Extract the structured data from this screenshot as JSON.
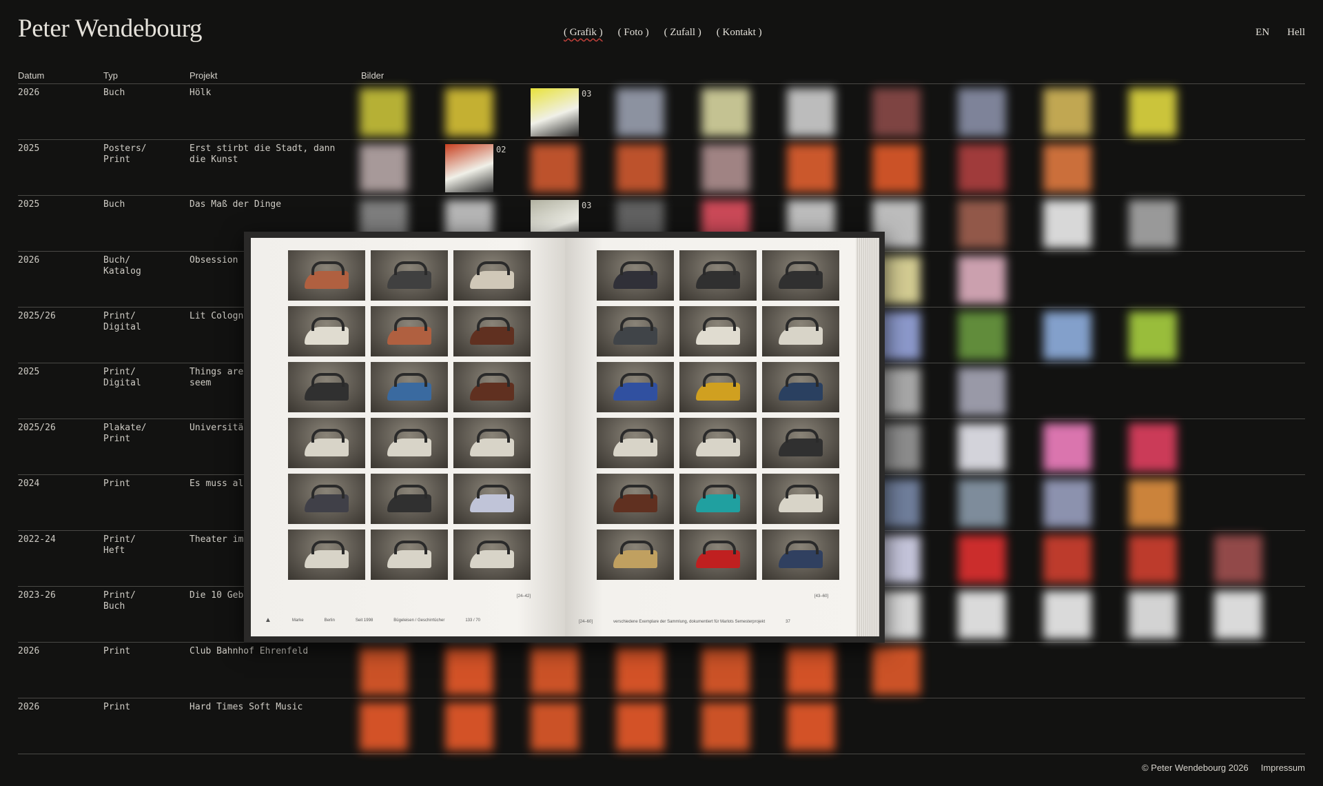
{
  "site": {
    "title": "Peter Wendebourg"
  },
  "nav": {
    "items": [
      "( Grafik )",
      "( Foto )",
      "( Zufall )",
      "( Kontakt )"
    ],
    "active": 0
  },
  "utility": {
    "language": "EN",
    "theme": "Hell"
  },
  "table": {
    "headers": {
      "date": "Datum",
      "type": "Typ",
      "project": "Projekt",
      "images": "Bilder"
    },
    "rows": [
      {
        "date": "2026",
        "type": "Buch",
        "project": "Hölk",
        "thumbs": 10,
        "sharp_index": 2,
        "count": "03",
        "colors": [
          "#c8c23a",
          "#d8c236",
          "#e8e23a",
          "#9aa0b0",
          "#d8d6a0",
          "#cfcfcf",
          "#8a4a48",
          "#8a90a8",
          "#d4b85a",
          "#e0d840"
        ]
      },
      {
        "date": "2025",
        "type": "Posters/\nPrint",
        "project": "Erst stirbt die Stadt, dann\ndie Kunst",
        "thumbs": 9,
        "sharp_index": 1,
        "count": "02",
        "colors": [
          "#b8a8a8",
          "#c84020",
          "#d05a30",
          "#d05a30",
          "#b09090",
          "#e06030",
          "#e05a2a",
          "#b04040",
          "#e07a40"
        ]
      },
      {
        "date": "2025",
        "type": "Buch",
        "project": "Das Maß der Dinge",
        "thumbs": 10,
        "sharp_index": 2,
        "count": "03",
        "colors": [
          "#8a8a8a",
          "#c8c8c8",
          "#b0b0a0",
          "#6a6a6a",
          "#e05060",
          "#d0d0d0",
          "#cfcfcf",
          "#a06050",
          "#eeeeee",
          "#a8a8a8"
        ]
      },
      {
        "date": "2026",
        "type": "Buch/\nKatalog",
        "project": "Obsession",
        "thumbs": 8,
        "sharp_index": -1,
        "count": "",
        "colors": [
          "#d0c8a0",
          "#c0c0c0",
          "#d0d0b0",
          "#a0a0a0",
          "#b0b0b0",
          "#c0c0b0",
          "#e8e0a0",
          "#e0b0c0"
        ]
      },
      {
        "date": "2025/26",
        "type": "Print/\nDigital",
        "project": "Lit Cologn",
        "thumbs": 10,
        "sharp_index": -1,
        "count": "",
        "colors": [
          "#a0a0d0",
          "#7080c0",
          "#8090c0",
          "#b0b0e0",
          "#8080a0",
          "#9090b0",
          "#9aa8e0",
          "#6a9a40",
          "#90b0e0",
          "#a8d040"
        ]
      },
      {
        "date": "2025",
        "type": "Print/\nDigital",
        "project": "Things are\nseem",
        "thumbs": 8,
        "sharp_index": -1,
        "count": "",
        "colors": [
          "#a0a0a0",
          "#c0c0c0",
          "#909090",
          "#b0b0b0",
          "#a8a8a8",
          "#c8c8c8",
          "#b8b8b8",
          "#a8a8b8"
        ]
      },
      {
        "date": "2025/26",
        "type": "Plakate/\nPrint",
        "project": "Universitä",
        "thumbs": 10,
        "sharp_index": -1,
        "count": "",
        "colors": [
          "#d0d0d0",
          "#c0c0c0",
          "#b0b0b0",
          "#c8c8c8",
          "#a0a0a0",
          "#c0c0c0",
          "#9a9a9a",
          "#e8e8f0",
          "#f080c0",
          "#e04060"
        ]
      },
      {
        "date": "2024",
        "type": "Print",
        "project": "Es muss al",
        "thumbs": 10,
        "sharp_index": -1,
        "count": "",
        "colors": [
          "#8080a0",
          "#7080a0",
          "#8090b0",
          "#9090a0",
          "#7a7a9a",
          "#8888a8",
          "#7a8aaa",
          "#8a9aaa",
          "#9aa0c0",
          "#e09040"
        ]
      },
      {
        "date": "2022-24",
        "type": "Print/\nHeft",
        "project": "Theater im",
        "thumbs": 11,
        "sharp_index": -1,
        "count": "",
        "colors": [
          "#c04040",
          "#b03030",
          "#d04040",
          "#a02020",
          "#c03030",
          "#c04040",
          "#d8d8f0",
          "#e03030",
          "#d04030",
          "#d04030",
          "#a05050"
        ]
      },
      {
        "date": "2023-26",
        "type": "Print/\nBuch",
        "project": "Die 10 Geb",
        "thumbs": 11,
        "sharp_index": -1,
        "count": "",
        "colors": [
          "#e0e0e0",
          "#d0d0d0",
          "#c8c8c8",
          "#e8e8e8",
          "#d8d8d8",
          "#e0e0e0",
          "#eeeeee",
          "#f0f0f0",
          "#f0f0f0",
          "#e8e8e8",
          "#f0f0f0"
        ]
      },
      {
        "date": "2026",
        "type": "Print",
        "project": "Club Bahnhof Ehrenfeld",
        "thumbs": 7,
        "sharp_index": -1,
        "count": "",
        "colors": [
          "#e05a2a",
          "#e85a2a",
          "#e05a2a",
          "#e85a2a",
          "#e05a2a",
          "#e85a2a",
          "#e05a2a"
        ]
      },
      {
        "date": "2026",
        "type": "Print",
        "project": "Hard Times Soft Music",
        "thumbs": 6,
        "sharp_index": -1,
        "count": "",
        "colors": [
          "#e85a2a",
          "#e85a2a",
          "#e05a2a",
          "#e85a2a",
          "#e05a2a",
          "#e85a2a"
        ]
      }
    ]
  },
  "book": {
    "left_range": "[24–42]",
    "right_range": "[43–60]",
    "left_footer": [
      "Marke",
      "Berlin",
      "Seit 1998",
      "Bügeleisen / Geschirrtücher",
      "133 / 70"
    ],
    "right_footer": [
      "[24–60]",
      "verschiedene Exemplare der Sammlung, dokumentiert für Marlots Semesterprojekt",
      "37"
    ],
    "left_iron_colors": [
      "#b06040",
      "#404040",
      "#d0c8b8",
      "#e0dcd0",
      "#b06040",
      "#603020",
      "#303030",
      "#3a6aa0",
      "#603020",
      "#d8d4c8",
      "#d8d4c8",
      "#d8d4c8",
      "#404048",
      "#303030",
      "#c0c4d8",
      "#d8d4c8",
      "#d8d4c8",
      "#d8d4c8"
    ],
    "right_iron_colors": [
      "#303038",
      "#303030",
      "#303030",
      "#404448",
      "#e0dcd0",
      "#d8d4c8",
      "#3050a0",
      "#d0a020",
      "#2a4060",
      "#d8d4c8",
      "#d8d4c8",
      "#303030",
      "#603020",
      "#20a0a0",
      "#d8d4c8",
      "#c0a060",
      "#c02020",
      "#304060"
    ]
  },
  "footer": {
    "copyright": "© Peter Wendebourg 2026",
    "imprint": "Impressum"
  }
}
